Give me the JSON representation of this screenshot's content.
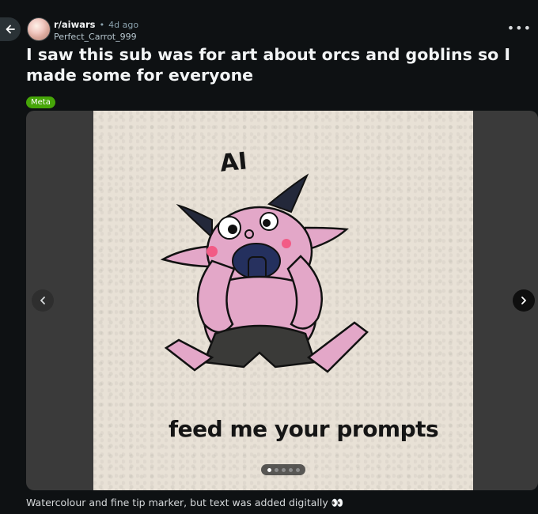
{
  "post": {
    "subreddit": "r/aiwars",
    "separator": "•",
    "age": "4d ago",
    "author": "Perfect_Carrot_999",
    "title": "I saw this sub was for art about orcs and goblins so I made some for everyone",
    "flair": "Meta",
    "caption": "Watercolour and fine tip marker, but text was added digitally 👀"
  },
  "image": {
    "text_top": "AI",
    "text_bottom": "feed me your prompts"
  },
  "gallery": {
    "total_slides": 5,
    "current_slide": 1
  },
  "colors": {
    "background": "#0e1113",
    "flair": "#46a508",
    "goblin_skin": "#e3a7c8",
    "shorts": "#3a3a38",
    "horns": "#23283a"
  },
  "icons": {
    "back": "arrow-left-icon",
    "more": "more-horizontal-icon",
    "prev": "chevron-left-icon",
    "next": "chevron-right-icon"
  }
}
